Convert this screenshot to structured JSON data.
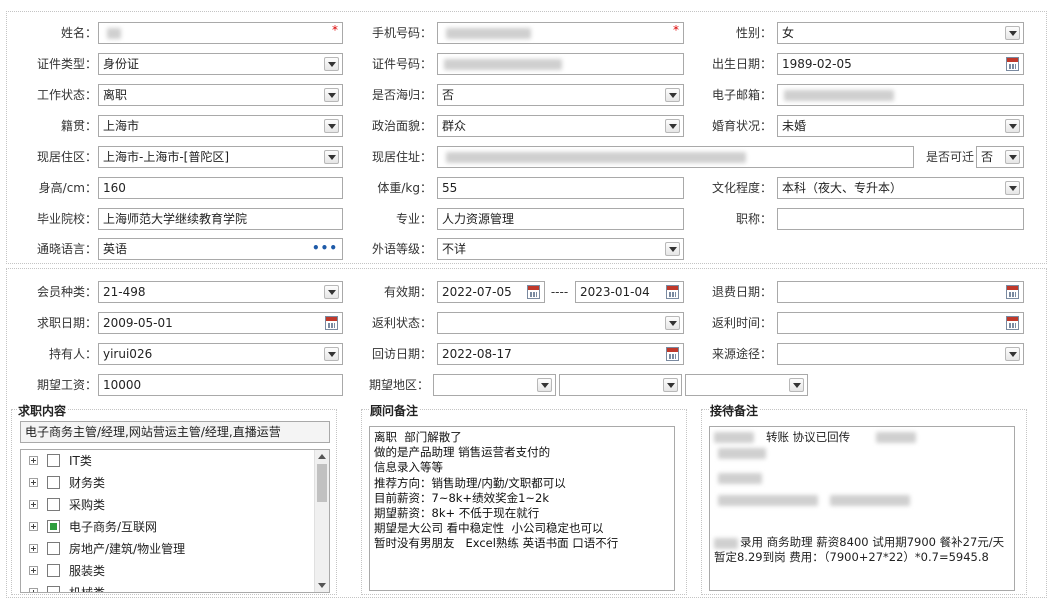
{
  "basic": {
    "name": {
      "label": "姓名：",
      "value": ""
    },
    "mobile": {
      "label": "手机号码：",
      "value": ""
    },
    "gender": {
      "label": "性别：",
      "value": "女"
    },
    "id_type": {
      "label": "证件类型：",
      "value": "身份证"
    },
    "id_number": {
      "label": "证件号码：",
      "value": ""
    },
    "birth_date": {
      "label": "出生日期：",
      "value": "1989-02-05"
    },
    "work_status": {
      "label": "工作状态：",
      "value": "离职"
    },
    "returnee": {
      "label": "是否海归：",
      "value": "否"
    },
    "email": {
      "label": "电子邮箱：",
      "value": ""
    },
    "native_place": {
      "label": "籍贯：",
      "value": "上海市"
    },
    "political": {
      "label": "政治面貌：",
      "value": "群众"
    },
    "marital": {
      "label": "婚育状况：",
      "value": "未婚"
    },
    "residence_area": {
      "label": "现居住区：",
      "value": "上海市-上海市-[普陀区]"
    },
    "residence_address": {
      "label": "现居住址：",
      "value": ""
    },
    "relocate": {
      "label": "是否可迁",
      "value": "否"
    },
    "height": {
      "label": "身高/cm：",
      "value": "160"
    },
    "weight": {
      "label": "体重/kg：",
      "value": "55"
    },
    "education": {
      "label": "文化程度：",
      "value": "本科（夜大、专升本）"
    },
    "school": {
      "label": "毕业院校：",
      "value": "上海师范大学继续教育学院"
    },
    "major": {
      "label": "专业：",
      "value": "人力资源管理"
    },
    "title": {
      "label": "职称：",
      "value": ""
    },
    "language": {
      "label": "通晓语言：",
      "value": "英语",
      "more": "•••"
    },
    "language_level": {
      "label": "外语等级：",
      "value": "不详"
    }
  },
  "member": {
    "member_type": {
      "label": "会员种类：",
      "value": "21-498"
    },
    "valid": {
      "label": "有效期：",
      "from": "2022-07-05",
      "sep": "----",
      "to": "2023-01-04"
    },
    "refund_date": {
      "label": "退费日期：",
      "value": ""
    },
    "job_date": {
      "label": "求职日期：",
      "value": "2009-05-01"
    },
    "rebate_status": {
      "label": "返利状态：",
      "value": ""
    },
    "rebate_time": {
      "label": "返利时间：",
      "value": ""
    },
    "holder": {
      "label": "持有人：",
      "value": "yirui026"
    },
    "visit_date": {
      "label": "回访日期：",
      "value": "2022-08-17"
    },
    "source": {
      "label": "来源途径：",
      "value": ""
    },
    "salary": {
      "label": "期望工资：",
      "value": "10000"
    },
    "area": {
      "label": "期望地区：",
      "v1": "",
      "v2": "",
      "v3": ""
    }
  },
  "job": {
    "title": "求职内容",
    "selected": "电子商务主管/经理,网站营运主管/经理,直播运营",
    "tree": [
      {
        "label": "IT类",
        "checked": false
      },
      {
        "label": "财务类",
        "checked": false
      },
      {
        "label": "采购类",
        "checked": false
      },
      {
        "label": "电子商务/互联网",
        "checked": true
      },
      {
        "label": "房地产/建筑/物业管理",
        "checked": false
      },
      {
        "label": "服装类",
        "checked": false
      },
      {
        "label": "机械类",
        "checked": false
      }
    ]
  },
  "consultant": {
    "title": "顾问备注",
    "text": "离职  部门解散了\n做的是产品助理 销售运营者支付的\n信息录入等等\n推荐方向：销售助理/内勤/文职都可以\n目前薪资：7~8k+绩效奖金1~2k\n期望薪资：8k+ 不低于现在就行\n期望是大公司 看中稳定性  小公司稳定也可以\n暂时没有男朋友   Excel熟练 英语书面 口语不行"
  },
  "reception": {
    "title": "接待备注",
    "line1": "转账  协议已回传",
    "line2": "录用 商务助理 薪资8400 试用期7900 餐补27元/天",
    "line3": "暂定8.29到岗 费用：（7900+27*22）*0.7=5945.8"
  },
  "colors": {
    "border": "#a9a9a9",
    "required": "#dd0000",
    "calendar": "#c0392b",
    "check": "#2e9e3e"
  }
}
